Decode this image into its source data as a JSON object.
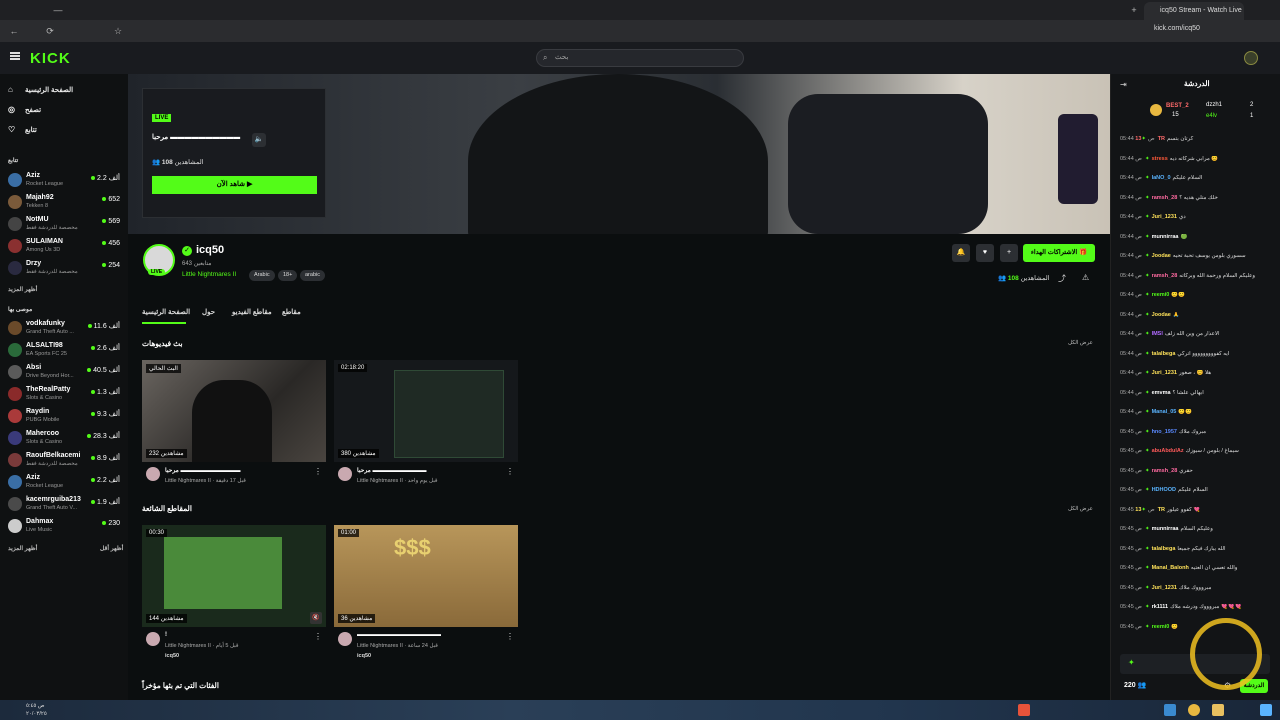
{
  "browser": {
    "tab_title": "icq50 Stream - Watch Live",
    "url": "kick.com/icq50"
  },
  "header": {
    "logo": "KICK",
    "search_placeholder": "بحث"
  },
  "sidebar": {
    "nav": [
      {
        "label": "الصفحة الرئيسية",
        "icon": "home-icon"
      },
      {
        "label": "تصفح",
        "icon": "compass-icon"
      },
      {
        "label": "تتابع",
        "icon": "heart-icon"
      }
    ],
    "following_heading": "تتابع",
    "following": [
      {
        "name": "Aziz",
        "game": "Rocket League",
        "viewers": "2.2 ألف",
        "color": "#3a6ea5"
      },
      {
        "name": "Majah92",
        "game": "Tekken 8",
        "viewers": "652",
        "color": "#7a5a3a"
      },
      {
        "name": "NotMU",
        "game": "مخصصة للدردشة فقط",
        "viewers": "569",
        "color": "#444444"
      },
      {
        "name": "SULAIMAN",
        "game": "Among Us 3D",
        "viewers": "456",
        "color": "#8a3030"
      },
      {
        "name": "Drzy",
        "game": "مخصصة للدردشة فقط",
        "viewers": "254",
        "color": "#2a2a40"
      }
    ],
    "show_more_1": "أظهر المزيد",
    "recommended_heading": "موصى بها",
    "recommended": [
      {
        "name": "vodkafunky",
        "game": "Grand Theft Auto ...",
        "viewers": "11.6 ألف",
        "color": "#6a4a2a"
      },
      {
        "name": "ALSALTI98",
        "game": "EA Sports FC 25",
        "viewers": "2.6 ألف",
        "color": "#2a6a3a"
      },
      {
        "name": "Absi",
        "game": "Drive Beyond Hor...",
        "viewers": "40.5 ألف",
        "color": "#5a5a5a"
      },
      {
        "name": "TheRealPatty",
        "game": "Slots & Casino",
        "viewers": "1.3 ألف",
        "color": "#8a2a2a"
      },
      {
        "name": "Raydin",
        "game": "PUBG Mobile",
        "viewers": "9.3 ألف",
        "color": "#aa3a3a"
      },
      {
        "name": "Mahercoo",
        "game": "Slots & Casino",
        "viewers": "28.3 ألف",
        "color": "#3a3a7a"
      },
      {
        "name": "RaoufBelkacemi",
        "game": "مخصصة للدردشة فقط",
        "viewers": "8.9 ألف",
        "color": "#7a3a3a"
      },
      {
        "name": "Aziz",
        "game": "Rocket League",
        "viewers": "2.2 ألف",
        "color": "#3a6ea5"
      },
      {
        "name": "kacemrguiba213",
        "game": "Grand Theft Auto V...",
        "viewers": "1.9 ألف",
        "color": "#4a4a4a"
      },
      {
        "name": "Dahmax",
        "game": "Live Music",
        "viewers": "230",
        "color": "#cccccc"
      }
    ],
    "show_more_2": "أظهر المزيد",
    "show_less": "أظهر أقل"
  },
  "live_card": {
    "badge": "LIVE",
    "title": "مرحبا ▬▬▬▬▬▬▬▬▬▬",
    "viewers": "108",
    "viewers_label": "المشاهدين",
    "watch_label": "شاهد الآن ▶"
  },
  "channel": {
    "name": "icq50",
    "followers": "643 متابعين",
    "game": "Little Nightmares II",
    "tags": [
      "Arabic",
      "18+",
      "arabic"
    ],
    "live_label": "LIVE",
    "subscribe_label": "الاشتراكات الهداء 🎁",
    "viewers": "108",
    "viewers_label": "المشاهدين"
  },
  "tabs": [
    "الصفحة الرئيسية",
    "حول",
    "مقاطع الفيديو",
    "مقاطع"
  ],
  "videos_section": {
    "title": "بث فيديوهات",
    "see_all": "عرض الكل",
    "items": [
      {
        "badge": "البث الحالي",
        "views": "232 مشاهدين",
        "title": "مرحبا ▬▬▬▬▬▬▬▬▬▬",
        "meta": "Little Nightmares II · قبل 17 دقيقة"
      },
      {
        "badge": "02:18:20",
        "views": "380 مشاهدين",
        "title": "مرحبا ▬▬▬▬▬▬▬▬▬",
        "meta": "Little Nightmares II · قبل يوم واحد"
      }
    ]
  },
  "clips_section": {
    "title": "المقاطع الشائعة",
    "see_all": "عرض الكل",
    "items": [
      {
        "badge": "00:30",
        "views": "144 مشاهدين",
        "title": "!",
        "meta": "Little Nightmares II · قبل 5 أيام",
        "author": "icq50"
      },
      {
        "badge": "01:00",
        "views": "36 مشاهدين",
        "title": "▬▬▬▬▬▬▬▬▬▬▬▬▬▬",
        "meta": "Little Nightmares II · قبل 24 ساعة",
        "author": "icq50"
      }
    ]
  },
  "recent_section": {
    "title": "الفئات التي تم بثها مؤخراً"
  },
  "chat": {
    "title": "الدردشة",
    "leaders": [
      {
        "name": "BEST_2",
        "count": "15"
      },
      {
        "name": "dzzh1",
        "count": "2"
      },
      {
        "name": "e4lv",
        "count": "1"
      }
    ],
    "messages": [
      {
        "time": "05:44 ص",
        "user": "13TR",
        "color": "#ff6a6a",
        "text": "كرتان بتسم"
      },
      {
        "time": "05:44 ص",
        "user": "stress",
        "color": "#ff5a3a",
        "text": "مرابي شركاته ديه 😊"
      },
      {
        "time": "05:44 ص",
        "user": "laNO_0",
        "color": "#5ab4ff",
        "text": "السلام عليكم"
      },
      {
        "time": "05:44 ص",
        "user": "ramsh_28",
        "color": "#ff6aa0",
        "text": "خلك متلي هديه ؟"
      },
      {
        "time": "05:44 ص",
        "user": "Juri_1231",
        "color": "#ffe25a",
        "text": "دي"
      },
      {
        "time": "05:44 ص",
        "user": "munnirraa",
        "color": "#ffffff",
        "text": "🟢"
      },
      {
        "time": "05:44 ص",
        "user": "Joodae",
        "color": "#ffe25a",
        "text": "سسوري بلومن يوسف تحبة تحيه"
      },
      {
        "time": "05:44 ص",
        "user": "ramsh_28",
        "color": "#ff6aa0",
        "text": "وعليكم السلام ورحمة الله وبركاته"
      },
      {
        "time": "05:44 ص",
        "user": "reemi0",
        "color": "#53fc18",
        "text": "🙂🙂"
      },
      {
        "time": "05:44 ص",
        "user": "Joodae",
        "color": "#ffe25a",
        "text": "🙏"
      },
      {
        "time": "05:44 ص",
        "user": "lMSl",
        "color": "#b06aff",
        "text": "الاعذار من وين الله زلف"
      },
      {
        "time": "05:44 ص",
        "user": "talalbega",
        "color": "#ffe25a",
        "text": "ايه كفووووووووو اتركي"
      },
      {
        "time": "05:44 ص",
        "user": "Juri_1231",
        "color": "#ffe25a",
        "text": "هلا 😊 ، صغور"
      },
      {
        "time": "05:44 ص",
        "user": "emvma",
        "color": "#ffffff",
        "text": "ابهالي علشا ؟"
      },
      {
        "time": "05:44 ص",
        "user": "Manal_05",
        "color": "#5ab4ff",
        "text": "🙂🙂"
      },
      {
        "time": "05:45 ص",
        "user": "hno_1957",
        "color": "#5a8aff",
        "text": "مبروك ملاك"
      },
      {
        "time": "05:45 ص",
        "user": "abuAbdulAz",
        "color": "#ff5a5a",
        "text": "سيماغ / بلومن / سيوزك"
      },
      {
        "time": "05:45 ص",
        "user": "ramsh_28",
        "color": "#ff6aa0",
        "text": "حقري"
      },
      {
        "time": "05:45 ص",
        "user": "HDHOOD",
        "color": "#5ab4ff",
        "text": "السلام عليكم"
      },
      {
        "time": "05:45 ص",
        "user": "13TR",
        "color": "#ffe25a",
        "text": "كفوو عيلور 💘"
      },
      {
        "time": "05:45 ص",
        "user": "munnirraa",
        "color": "#ffffff",
        "text": "وعليكم السلام"
      },
      {
        "time": "05:45 ص",
        "user": "talalbega",
        "color": "#ffe25a",
        "text": "الله يبارك فيكم جميعاً"
      },
      {
        "time": "05:45 ص",
        "user": "Manal_Balonh",
        "color": "#ffe25a",
        "text": "والله تعسي ان العتيه"
      },
      {
        "time": "05:45 ص",
        "user": "Juri_1231",
        "color": "#ffe25a",
        "text": "مبروووك ملاك"
      },
      {
        "time": "05:45 ص",
        "user": "rk1111",
        "color": "#ffffff",
        "text": "مبروووك ودرشه ملاك 💘💘💘"
      },
      {
        "time": "05:45 ص",
        "user": "reemi0",
        "color": "#53fc18",
        "text": "🙂"
      }
    ],
    "viewers": "220",
    "send_label": "الدردشة"
  },
  "taskbar": {
    "time": "ص ٥:٤٥",
    "date": "٢٠/٠٣/٢٥"
  }
}
